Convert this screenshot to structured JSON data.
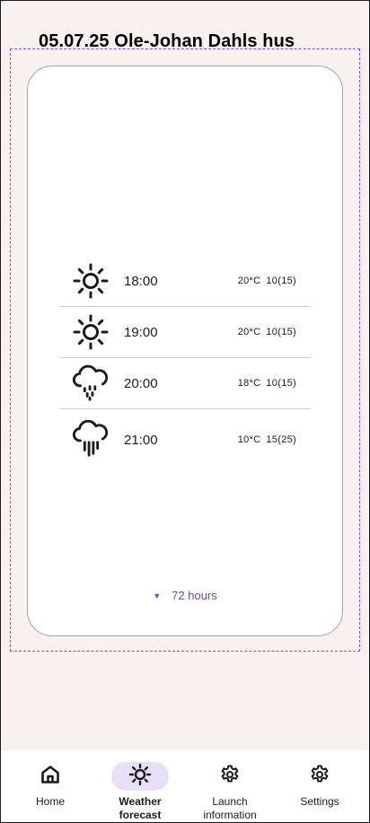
{
  "header": {
    "title": "05.07.25 Ole-Johan Dahls hus"
  },
  "forecast": {
    "rows": [
      {
        "icon": "sun-icon",
        "time": "18:00",
        "temp": "20*C",
        "wind": "10(15)"
      },
      {
        "icon": "sun-icon",
        "time": "19:00",
        "temp": "20*C",
        "wind": "10(15)"
      },
      {
        "icon": "rain-cloud-icon",
        "time": "20:00",
        "temp": "18*C",
        "wind": "10(15)"
      },
      {
        "icon": "heavy-rain-cloud-icon",
        "time": "21:00",
        "temp": "10*C",
        "wind": "15(25)"
      }
    ],
    "more_label": "72 hours"
  },
  "nav": {
    "items": [
      {
        "label": "Home",
        "icon": "home-icon",
        "active": false
      },
      {
        "label": "Weather forecast",
        "icon": "sun-icon",
        "active": true
      },
      {
        "label": "Launch information",
        "icon": "gear-icon",
        "active": false
      },
      {
        "label": "Settings",
        "icon": "gear-icon",
        "active": false
      }
    ]
  },
  "colors": {
    "accent": "#6750a4",
    "active_pill": "#e8def8",
    "dash": "#7c4dff",
    "background": "#f8f1f2"
  }
}
